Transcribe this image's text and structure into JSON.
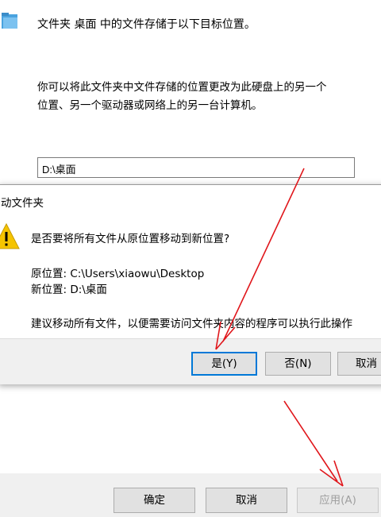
{
  "properties_page": {
    "header_text": "文件夹 桌面 中的文件存储于以下目标位置。",
    "description_line1": "你可以将此文件夹中文件存储的位置更改为此硬盘上的另一个",
    "description_line2": "位置、另一个驱动器或网络上的另一台计算机。",
    "path_value": "D:\\桌面",
    "buttons": {
      "ok": "确定",
      "cancel": "取消",
      "apply": "应用(A)"
    }
  },
  "move_dialog": {
    "title": "动文件夹",
    "question": "是否要将所有文件从原位置移动到新位置?",
    "original_location": "原位置: C:\\Users\\xiaowu\\Desktop",
    "new_location": "新位置: D:\\桌面",
    "advice": "建议移动所有文件，以便需要访问文件夹内容的程序可以执行此操作",
    "buttons": {
      "yes": "是(Y)",
      "no": "否(N)",
      "cancel": "取消"
    }
  },
  "colors": {
    "accent_blue": "#0078d7",
    "warning_yellow": "#f5c400",
    "arrow_red": "#e0161b"
  }
}
